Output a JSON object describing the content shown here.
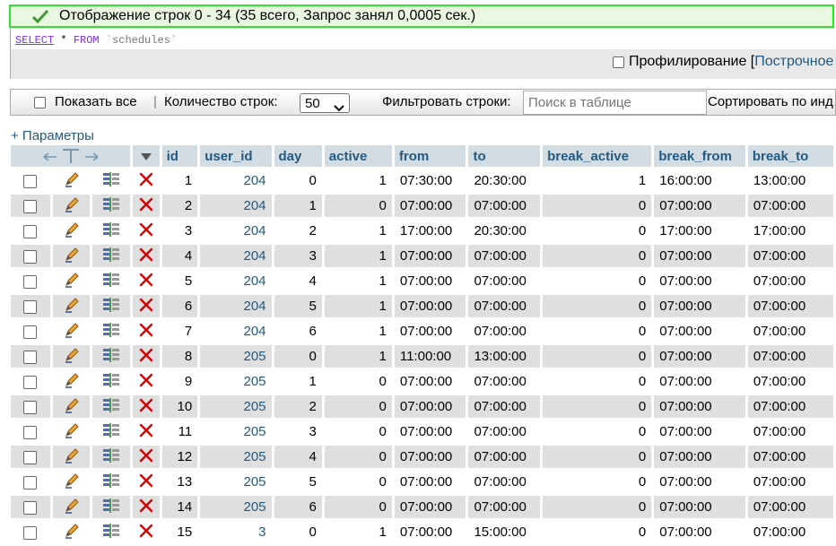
{
  "success": {
    "message": "Отображение строк 0 - 34 (35 всего, Запрос занял 0,0005 сек.)",
    "icon": "check-icon"
  },
  "sql": {
    "select": "SELECT",
    "star": "*",
    "from": "FROM",
    "table": "`schedules`"
  },
  "profiling": {
    "label": "Профилирование [",
    "link": "Построчное"
  },
  "navbar": {
    "show_all": "Показать все",
    "separator": "|",
    "row_count_label": "Количество строк:",
    "row_count_value": "50",
    "filter_label": "Фильтровать строки:",
    "search_placeholder": "Поиск в таблице",
    "sort_label": "Сортировать по инд"
  },
  "options_link": "+ Параметры",
  "columns": [
    "id",
    "user_id",
    "day",
    "active",
    "from",
    "to",
    "break_active",
    "break_from",
    "break_to"
  ],
  "rows": [
    [
      "1",
      "204",
      "0",
      "1",
      "07:30:00",
      "20:30:00",
      "1",
      "16:00:00",
      "13:00:00"
    ],
    [
      "2",
      "204",
      "1",
      "0",
      "07:00:00",
      "07:00:00",
      "0",
      "07:00:00",
      "07:00:00"
    ],
    [
      "3",
      "204",
      "2",
      "1",
      "17:00:00",
      "20:30:00",
      "0",
      "17:00:00",
      "17:00:00"
    ],
    [
      "4",
      "204",
      "3",
      "1",
      "07:00:00",
      "07:00:00",
      "0",
      "07:00:00",
      "07:00:00"
    ],
    [
      "5",
      "204",
      "4",
      "1",
      "07:00:00",
      "07:00:00",
      "0",
      "07:00:00",
      "07:00:00"
    ],
    [
      "6",
      "204",
      "5",
      "1",
      "07:00:00",
      "07:00:00",
      "0",
      "07:00:00",
      "07:00:00"
    ],
    [
      "7",
      "204",
      "6",
      "1",
      "07:00:00",
      "07:00:00",
      "0",
      "07:00:00",
      "07:00:00"
    ],
    [
      "8",
      "205",
      "0",
      "1",
      "11:00:00",
      "13:00:00",
      "0",
      "07:00:00",
      "07:00:00"
    ],
    [
      "9",
      "205",
      "1",
      "0",
      "07:00:00",
      "07:00:00",
      "0",
      "07:00:00",
      "07:00:00"
    ],
    [
      "10",
      "205",
      "2",
      "0",
      "07:00:00",
      "07:00:00",
      "0",
      "07:00:00",
      "07:00:00"
    ],
    [
      "11",
      "205",
      "3",
      "0",
      "07:00:00",
      "07:00:00",
      "0",
      "07:00:00",
      "07:00:00"
    ],
    [
      "12",
      "205",
      "4",
      "0",
      "07:00:00",
      "07:00:00",
      "0",
      "07:00:00",
      "07:00:00"
    ],
    [
      "13",
      "205",
      "5",
      "0",
      "07:00:00",
      "07:00:00",
      "0",
      "07:00:00",
      "07:00:00"
    ],
    [
      "14",
      "205",
      "6",
      "0",
      "07:00:00",
      "07:00:00",
      "0",
      "07:00:00",
      "07:00:00"
    ],
    [
      "15",
      "3",
      "0",
      "1",
      "07:00:00",
      "15:00:00",
      "0",
      "07:00:00",
      "07:00:00"
    ]
  ],
  "colors": {
    "header_bg": "#d3dce3",
    "link": "#235a81",
    "success_border": "#2ee52e",
    "success_bg": "#ebf8e1",
    "row_even": "#dfdfdf",
    "delete": "#d40000"
  }
}
